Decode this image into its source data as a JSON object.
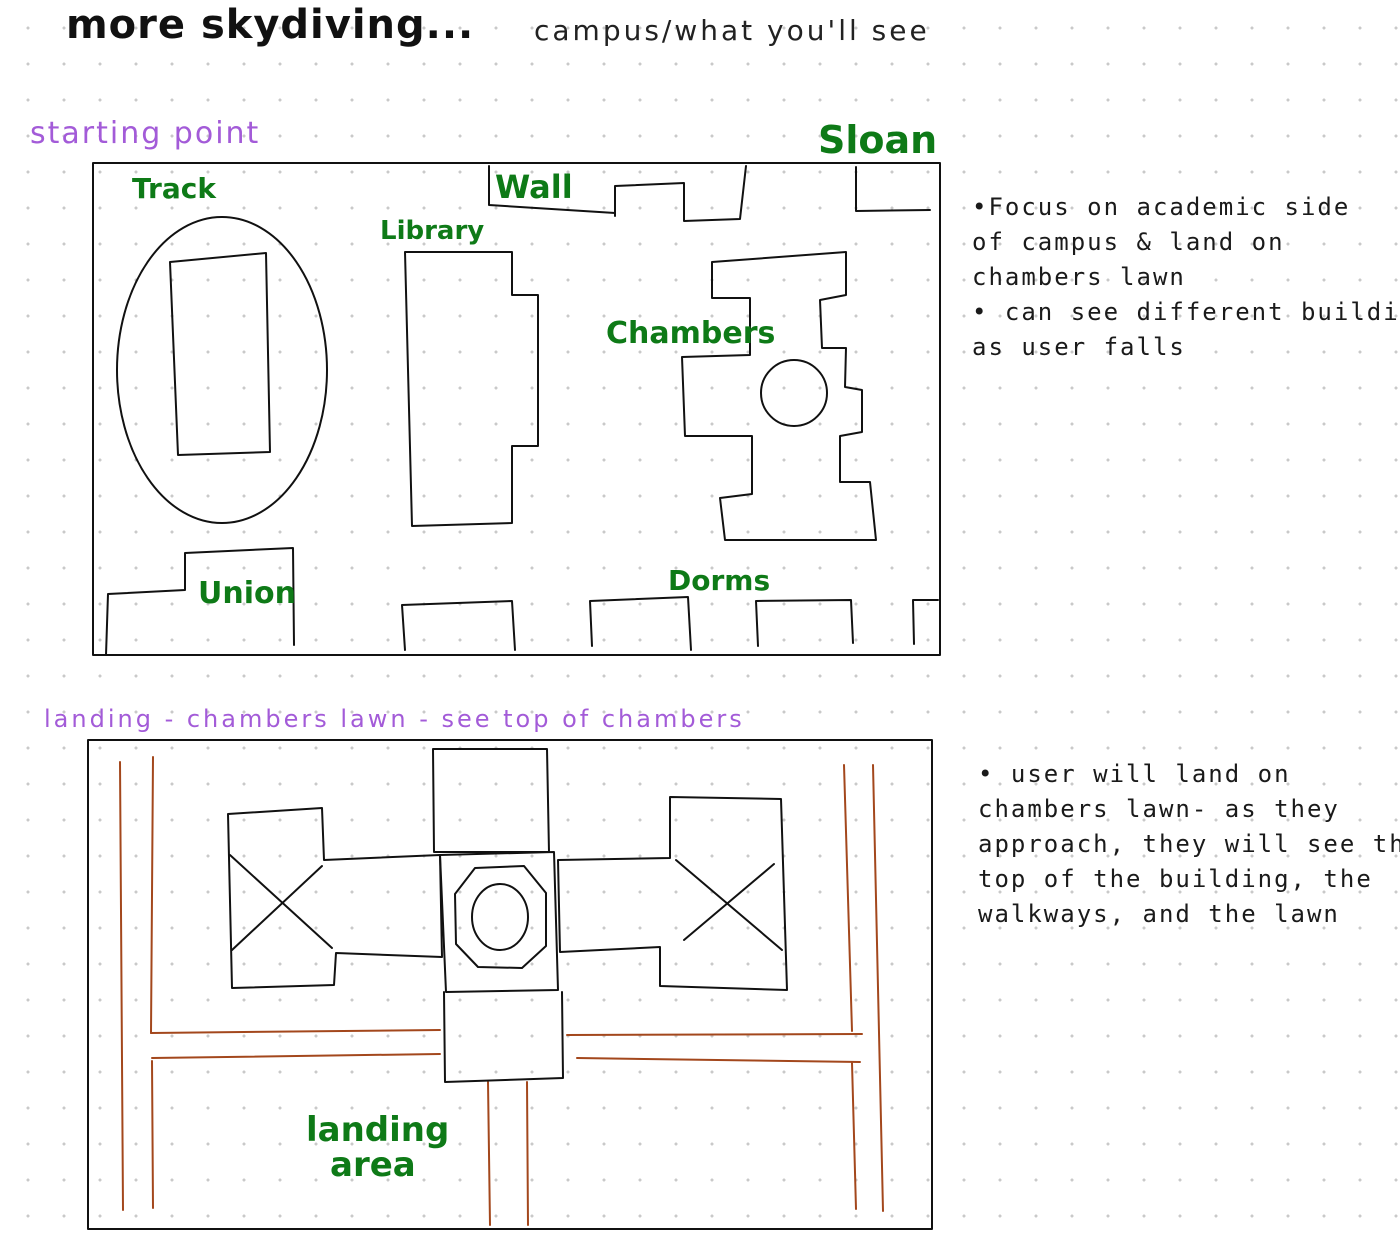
{
  "page": {
    "title": "more skydiving...",
    "subtitle": "campus/what you'll see"
  },
  "section_start": {
    "heading": "starting point",
    "labels": {
      "sloan": "Sloan",
      "track": "Track",
      "wall": "Wall",
      "library": "Library",
      "chambers": "Chambers",
      "union": "Union",
      "dorms": "Dorms"
    },
    "notes": [
      "•Focus on academic side",
      "of campus & land on",
      "chambers lawn",
      "• can see different buildings",
      " as user falls"
    ]
  },
  "section_landing": {
    "heading": "landing - chambers lawn - see top of chambers",
    "labels": {
      "landing_area_line1": "landing",
      "landing_area_line2": "area"
    },
    "notes": [
      "• user will land on",
      "chambers lawn- as they",
      "approach, they will see the",
      " top of the building, the",
      "walkways, and the lawn"
    ]
  },
  "colors": {
    "label_green": "#0e7a17",
    "heading_purple": "#a35bd8",
    "path_brown": "#a3471c",
    "ink": "#111111"
  }
}
